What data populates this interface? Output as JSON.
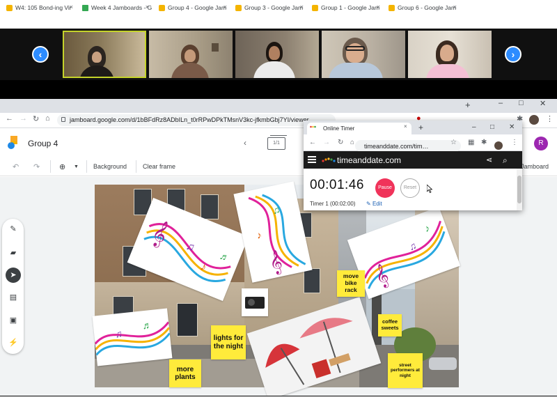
{
  "zoom": {
    "prev_arrow": "‹",
    "next_arrow": "›"
  },
  "browser": {
    "tabs": [
      {
        "label": "W4: 105 Bond-ing Vir",
        "favicon_color": "#f4b400"
      },
      {
        "label": "Week 4 Jamboards - G",
        "favicon_color": "#34a853"
      },
      {
        "label": "Group 4 - Google Jam",
        "favicon_color": "#f4b400"
      },
      {
        "label": "Group 3 - Google Jam",
        "favicon_color": "#f4b400"
      },
      {
        "label": "Group 1 - Google Jam",
        "favicon_color": "#f4b400"
      },
      {
        "label": "Group 6 - Google Jam",
        "favicon_color": "#f4b400"
      }
    ],
    "new_tab": "+",
    "url": "jamboard.google.com/d/1bBFdRz8ADbILn_t0rRPwDPkTMsnV3kc-jfkmbGbj7YI/viewer",
    "profile_initial": "R"
  },
  "jamboard": {
    "title": "Group 4",
    "frame_counter": "1/1",
    "toolbar": {
      "background_label": "Background",
      "clear_frame_label": "Clear frame",
      "jamboard_label": "Jamboard"
    },
    "stickies": [
      {
        "text": "move bike rack"
      },
      {
        "text": "coffee sweets"
      },
      {
        "text": "lights for the night"
      },
      {
        "text": "more plants"
      },
      {
        "text": "street performers at night"
      }
    ],
    "accent": "#f4b400"
  },
  "timer_popup": {
    "tab_title": "Online Timer",
    "url": "timeanddate.com/tim…",
    "site_name": "timeanddate.com",
    "time": "00:01:46",
    "pause_label": "Pause",
    "reset_label": "Reset",
    "timer_label": "Timer 1 (00:02:00)",
    "edit_label": "Edit",
    "pause_color": "#f0335a"
  }
}
